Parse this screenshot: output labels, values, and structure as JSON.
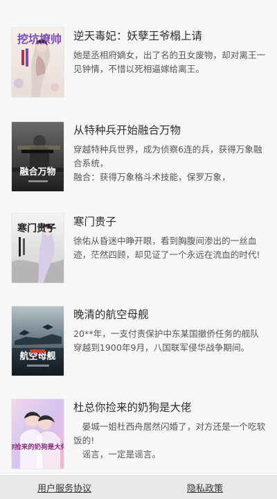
{
  "books": [
    {
      "title": "逆天毒妃：妖孽王爷榻上请",
      "desc": "她是丞相府嫡女，出了名的丑女废物，却对离王一见钟情，不惜以死相逼嫁给离王。",
      "cover_text": "挖坑撩帅"
    },
    {
      "title": "从特种兵开始融合万物",
      "desc": "穿越特种兵世界，成为侦察6连的兵，获得万象融合系统，\n融合：获得万象格斗术技能，保罗万象，",
      "cover_text": "融合万物"
    },
    {
      "title": "寒门贵子",
      "desc": "徐佑从昏迷中睁开眼，看到胸腹间渗出的一丝血迹，茫然四顾，却见证了一个永远在流血的时代!",
      "cover_text": "寒门贵子"
    },
    {
      "title": "晚清的航空母舰",
      "desc": "20**年，一支付责保护中东某国撤侨任务的舰队穿越到1900年9月，八国联军侵华战争期间。",
      "cover_text": "航空母舰"
    },
    {
      "title": "杜总你捡来的奶狗是大佬",
      "desc": "　晏城一姐杜西舟居然闪婚了，对方还是一个吃软饭的!\n　谣言，一定是谣言。",
      "cover_text": "你捡来的奶狗是大佬"
    }
  ],
  "footer": {
    "terms_label": "用户服务协议",
    "privacy_label": "隐私政策"
  },
  "colors": {
    "page_bg": "#f7f7f7",
    "footer_bg": "#e8e8e8",
    "title_text": "#2d2d2d",
    "desc_text": "#555555"
  }
}
